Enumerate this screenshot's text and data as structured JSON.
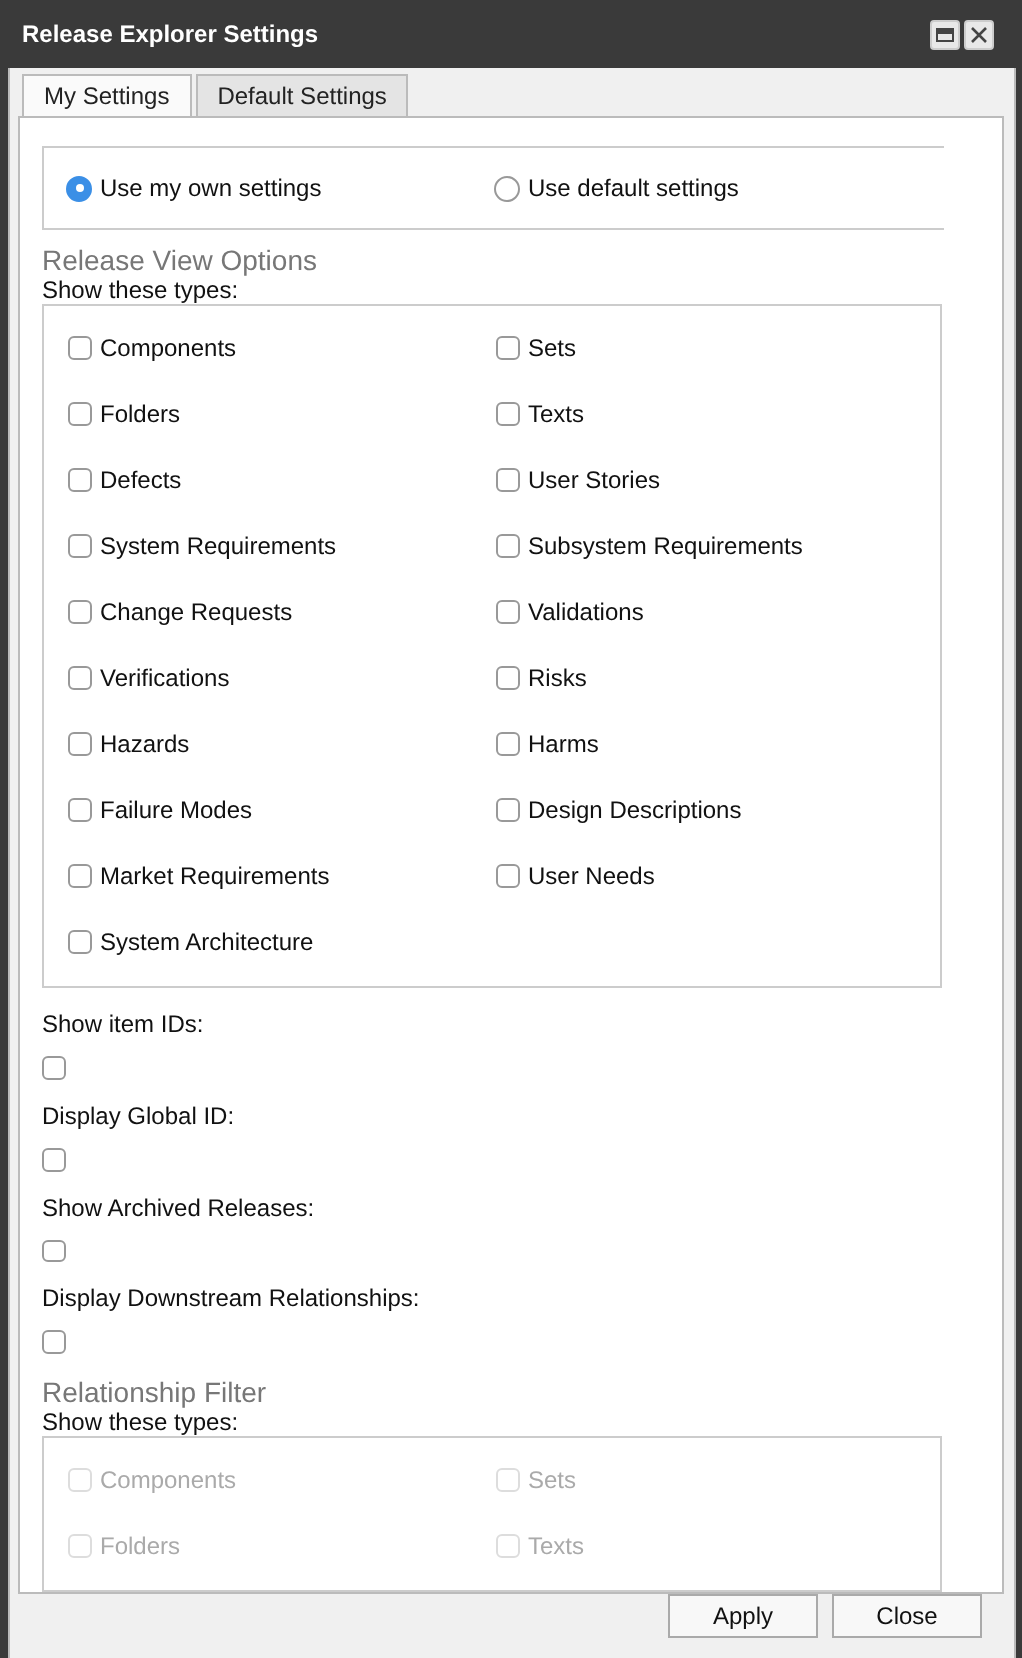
{
  "window": {
    "title": "Release Explorer Settings"
  },
  "tabs": [
    {
      "label": "My Settings",
      "selected": true
    },
    {
      "label": "Default Settings",
      "selected": false
    }
  ],
  "mode_options": [
    {
      "label": "Use my own settings",
      "selected": true
    },
    {
      "label": "Use default settings",
      "selected": false
    }
  ],
  "release_view_options": {
    "heading": "Release View Options",
    "subheading": "Show these types:",
    "disabled": false,
    "types": [
      {
        "label": "Components",
        "checked": false
      },
      {
        "label": "Sets",
        "checked": false
      },
      {
        "label": "Folders",
        "checked": false
      },
      {
        "label": "Texts",
        "checked": false
      },
      {
        "label": "Defects",
        "checked": false
      },
      {
        "label": "User Stories",
        "checked": false
      },
      {
        "label": "System Requirements",
        "checked": false
      },
      {
        "label": "Subsystem Requirements",
        "checked": false
      },
      {
        "label": "Change Requests",
        "checked": false
      },
      {
        "label": "Validations",
        "checked": false
      },
      {
        "label": "Verifications",
        "checked": false
      },
      {
        "label": "Risks",
        "checked": false
      },
      {
        "label": "Hazards",
        "checked": false
      },
      {
        "label": "Harms",
        "checked": false
      },
      {
        "label": "Failure Modes",
        "checked": false
      },
      {
        "label": "Design Descriptions",
        "checked": false
      },
      {
        "label": "Market Requirements",
        "checked": false
      },
      {
        "label": "User Needs",
        "checked": false
      },
      {
        "label": "System Architecture",
        "checked": false
      }
    ]
  },
  "settings": [
    {
      "label": "Show item IDs:",
      "checked": false
    },
    {
      "label": "Display Global ID:",
      "checked": false
    },
    {
      "label": "Show Archived Releases:",
      "checked": false
    },
    {
      "label": "Display Downstream Relationships:",
      "checked": false
    }
  ],
  "relationship_filter": {
    "heading": "Relationship Filter",
    "subheading": "Show these types:",
    "disabled": true,
    "types": [
      {
        "label": "Components",
        "checked": false
      },
      {
        "label": "Sets",
        "checked": false
      },
      {
        "label": "Folders",
        "checked": false
      },
      {
        "label": "Texts",
        "checked": false
      }
    ]
  },
  "buttons": [
    {
      "label": "Apply"
    },
    {
      "label": "Close"
    }
  ]
}
